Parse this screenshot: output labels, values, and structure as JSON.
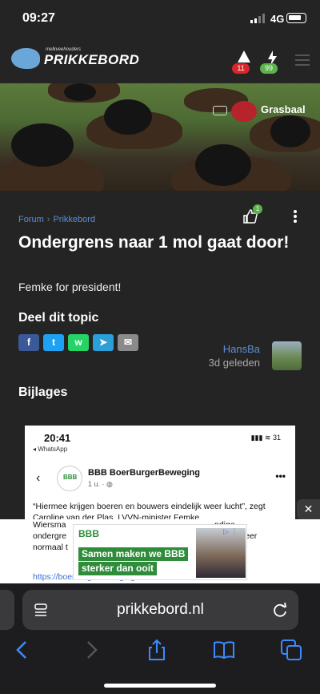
{
  "status": {
    "time": "09:27",
    "network": "4G"
  },
  "header": {
    "logo_small": "melkveehouders",
    "logo": "PRIKKEBORD",
    "alerts_count": "11",
    "messages_count": "99",
    "menu_icon": "hamburger-icon"
  },
  "hero": {
    "username": "Grasbaal"
  },
  "topic": {
    "breadcrumbs": [
      "Forum",
      "Prikkebord"
    ],
    "likes": "1",
    "title": "Ondergrens naar 1 mol gaat door!",
    "body": "Femke for president!",
    "share_heading": "Deel dit topic",
    "share": [
      {
        "label": "f",
        "color": "#3b5998",
        "icon": "facebook-icon"
      },
      {
        "label": "t",
        "color": "#1da1f2",
        "icon": "twitter-icon"
      },
      {
        "label": "w",
        "color": "#25d366",
        "icon": "whatsapp-icon"
      },
      {
        "label": "➤",
        "color": "#2a9fd8",
        "icon": "telegram-icon"
      },
      {
        "label": "✉",
        "color": "#8a8a8a",
        "icon": "mail-icon"
      }
    ],
    "author": "HansBa",
    "posted": "3d geleden",
    "attachments_heading": "Bijlages"
  },
  "attachment": {
    "time": "20:41",
    "back": "◂ WhatsApp",
    "battery": "31",
    "page_name": "BBB BoerBurgerBeweging",
    "meta": "1 u. · ",
    "logo": "BBB",
    "text": "“Hiermee krijgen boeren en bouwers eindelijk weer lucht”, zegt Caroline van der Plas. LVVN-minister Femke"
  },
  "overlay_text": {
    "line1": "Wiersma",
    "line1_tail": "ndige",
    "line2": "ondergre",
    "line2_tail": "om weer",
    "line3": "normaal t",
    "link": "https://boerburgerbeweging.nl/rac..."
  },
  "ad": {
    "logo": "BBB",
    "line1": "Samen maken we BBB",
    "line2": "sterker dan ooit",
    "choice": "▷ ⋮"
  },
  "browser": {
    "url": "prikkebord.nl"
  }
}
